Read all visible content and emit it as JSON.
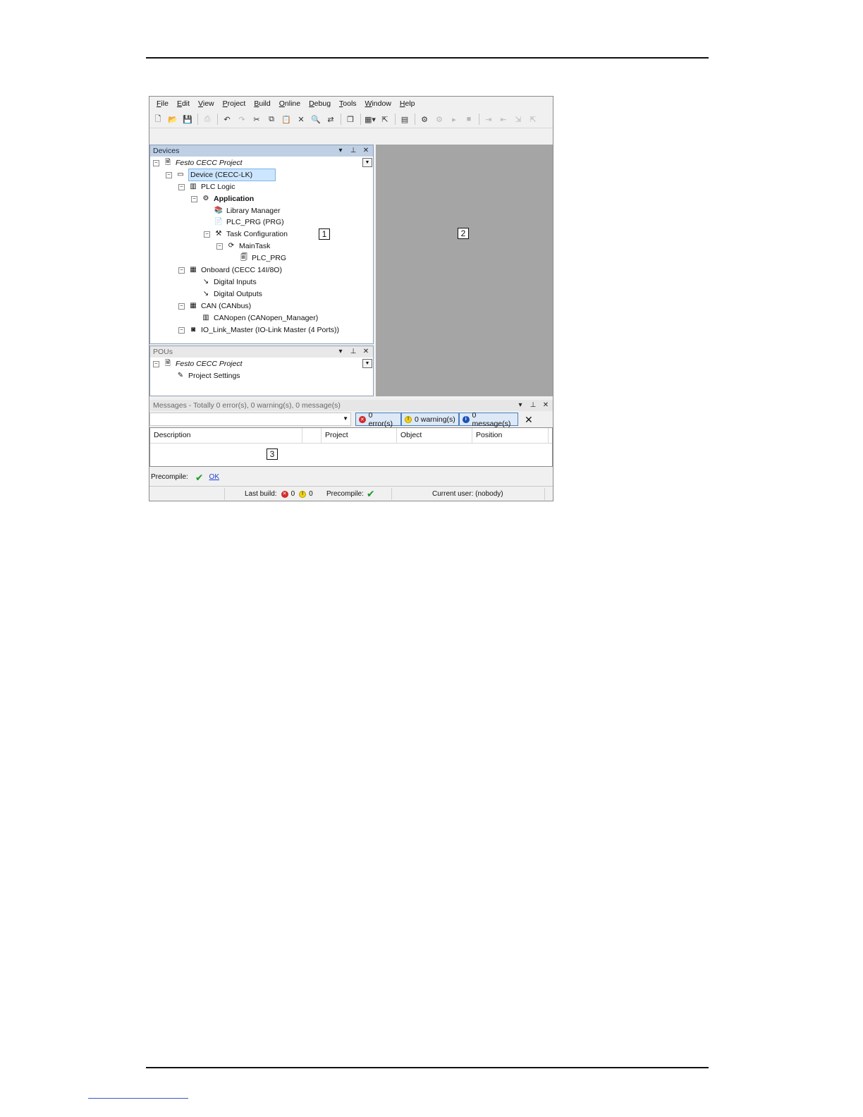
{
  "menu": [
    "File",
    "Edit",
    "View",
    "Project",
    "Build",
    "Online",
    "Debug",
    "Tools",
    "Window",
    "Help"
  ],
  "menu_mnemonics": [
    "F",
    "E",
    "V",
    "P",
    "B",
    "O",
    "D",
    "T",
    "W",
    "H"
  ],
  "toolbar_icons": [
    "new-file-icon",
    "open-folder-icon",
    "save-icon",
    "print-icon",
    "undo-icon",
    "redo-icon",
    "cut-icon",
    "copy-icon",
    "paste-icon",
    "delete-icon",
    "find-icon",
    "replace-icon",
    "copy-window-icon",
    "add-object-icon",
    "insert-icon",
    "build-icon",
    "generate-icon",
    "login-icon",
    "logout-icon",
    "start-icon",
    "stop-icon",
    "step-icon",
    "step-over-icon",
    "step-into-icon",
    "step-out-icon"
  ],
  "devices_panel": {
    "title": "Devices",
    "tree": [
      {
        "label": "Festo CECC Project"
      },
      {
        "label": "Device (CECC-LK)"
      },
      {
        "label": "PLC Logic"
      },
      {
        "label": "Application"
      },
      {
        "label": "Library Manager"
      },
      {
        "label": "PLC_PRG (PRG)"
      },
      {
        "label": "Task Configuration"
      },
      {
        "label": "MainTask"
      },
      {
        "label": "PLC_PRG"
      },
      {
        "label": "Onboard (CECC 14I/8O)"
      },
      {
        "label": "Digital Inputs"
      },
      {
        "label": "Digital Outputs"
      },
      {
        "label": "CAN (CANbus)"
      },
      {
        "label": "CANopen (CANopen_Manager)"
      },
      {
        "label": "IO_Link_Master (IO-Link Master (4 Ports))"
      }
    ],
    "marker": "1"
  },
  "editor_marker": "2",
  "pous_panel": {
    "title": "POUs",
    "tree": [
      {
        "label": "Festo CECC Project"
      },
      {
        "label": "Project Settings"
      }
    ]
  },
  "messages": {
    "title": "Messages - Totally 0 error(s), 0 warning(s), 0 message(s)",
    "errors_label": "0 error(s)",
    "warnings_label": "0 warning(s)",
    "messages_label": "0 message(s)",
    "columns": [
      "Description",
      "Project",
      "Object",
      "Position"
    ],
    "marker": "3",
    "precompile_label": "Precompile:",
    "precompile_link": "OK"
  },
  "statusbar": {
    "last_build_label": "Last build:",
    "errors": "0",
    "warnings": "0",
    "precompile_label": "Precompile:",
    "current_user": "Current user: (nobody)"
  },
  "colors": {
    "panel_title_active": "#bfcfe4",
    "editor_bg": "#a5a5a5",
    "selection": "#cce6ff",
    "error": "#d12b2b",
    "warning": "#f5d40f",
    "info": "#1d52b5",
    "ok_check": "#1c9a2c"
  }
}
